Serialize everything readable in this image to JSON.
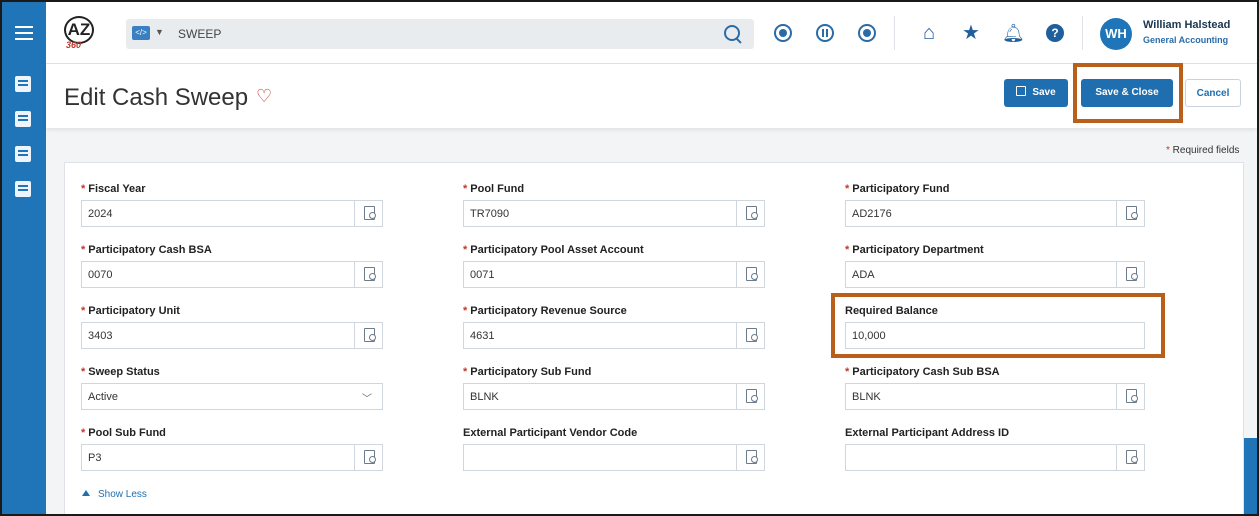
{
  "header": {
    "search_context": "SWEEP",
    "user_name": "William Halstead",
    "user_role": "General Accounting",
    "user_initials": "WH",
    "help_label": "?"
  },
  "page": {
    "title": "Edit Cash Sweep",
    "save_label": "Save",
    "save_close_label": "Save & Close",
    "cancel_label": "Cancel",
    "required_note": "Required fields",
    "show_less": "Show Less"
  },
  "fields": {
    "fiscal_year": {
      "label": "Fiscal Year",
      "value": "2024"
    },
    "pool_fund": {
      "label": "Pool Fund",
      "value": "TR7090"
    },
    "participatory_fund": {
      "label": "Participatory Fund",
      "value": "AD2176"
    },
    "participatory_cash_bsa": {
      "label": "Participatory Cash BSA",
      "value": "0070"
    },
    "participatory_pool_asset_account": {
      "label": "Participatory Pool Asset Account",
      "value": "0071"
    },
    "participatory_department": {
      "label": "Participatory Department",
      "value": "ADA"
    },
    "participatory_unit": {
      "label": "Participatory Unit",
      "value": "3403"
    },
    "participatory_revenue_source": {
      "label": "Participatory Revenue Source",
      "value": "4631"
    },
    "required_balance": {
      "label": "Required Balance",
      "value": "10,000"
    },
    "sweep_status": {
      "label": "Sweep Status",
      "value": "Active"
    },
    "participatory_sub_fund": {
      "label": "Participatory Sub Fund",
      "value": "BLNK"
    },
    "participatory_cash_sub_bsa": {
      "label": "Participatory Cash Sub BSA",
      "value": "BLNK"
    },
    "pool_sub_fund": {
      "label": "Pool Sub Fund",
      "value": "P3"
    },
    "external_participant_vendor_code": {
      "label": "External Participant Vendor Code",
      "value": ""
    },
    "external_participant_address_id": {
      "label": "External Participant Address ID",
      "value": ""
    }
  },
  "colors": {
    "brand_blue": "#1f75b8",
    "button_blue": "#1f6fb0",
    "highlight": "#b85f1c",
    "required_star": "#c0392b"
  }
}
